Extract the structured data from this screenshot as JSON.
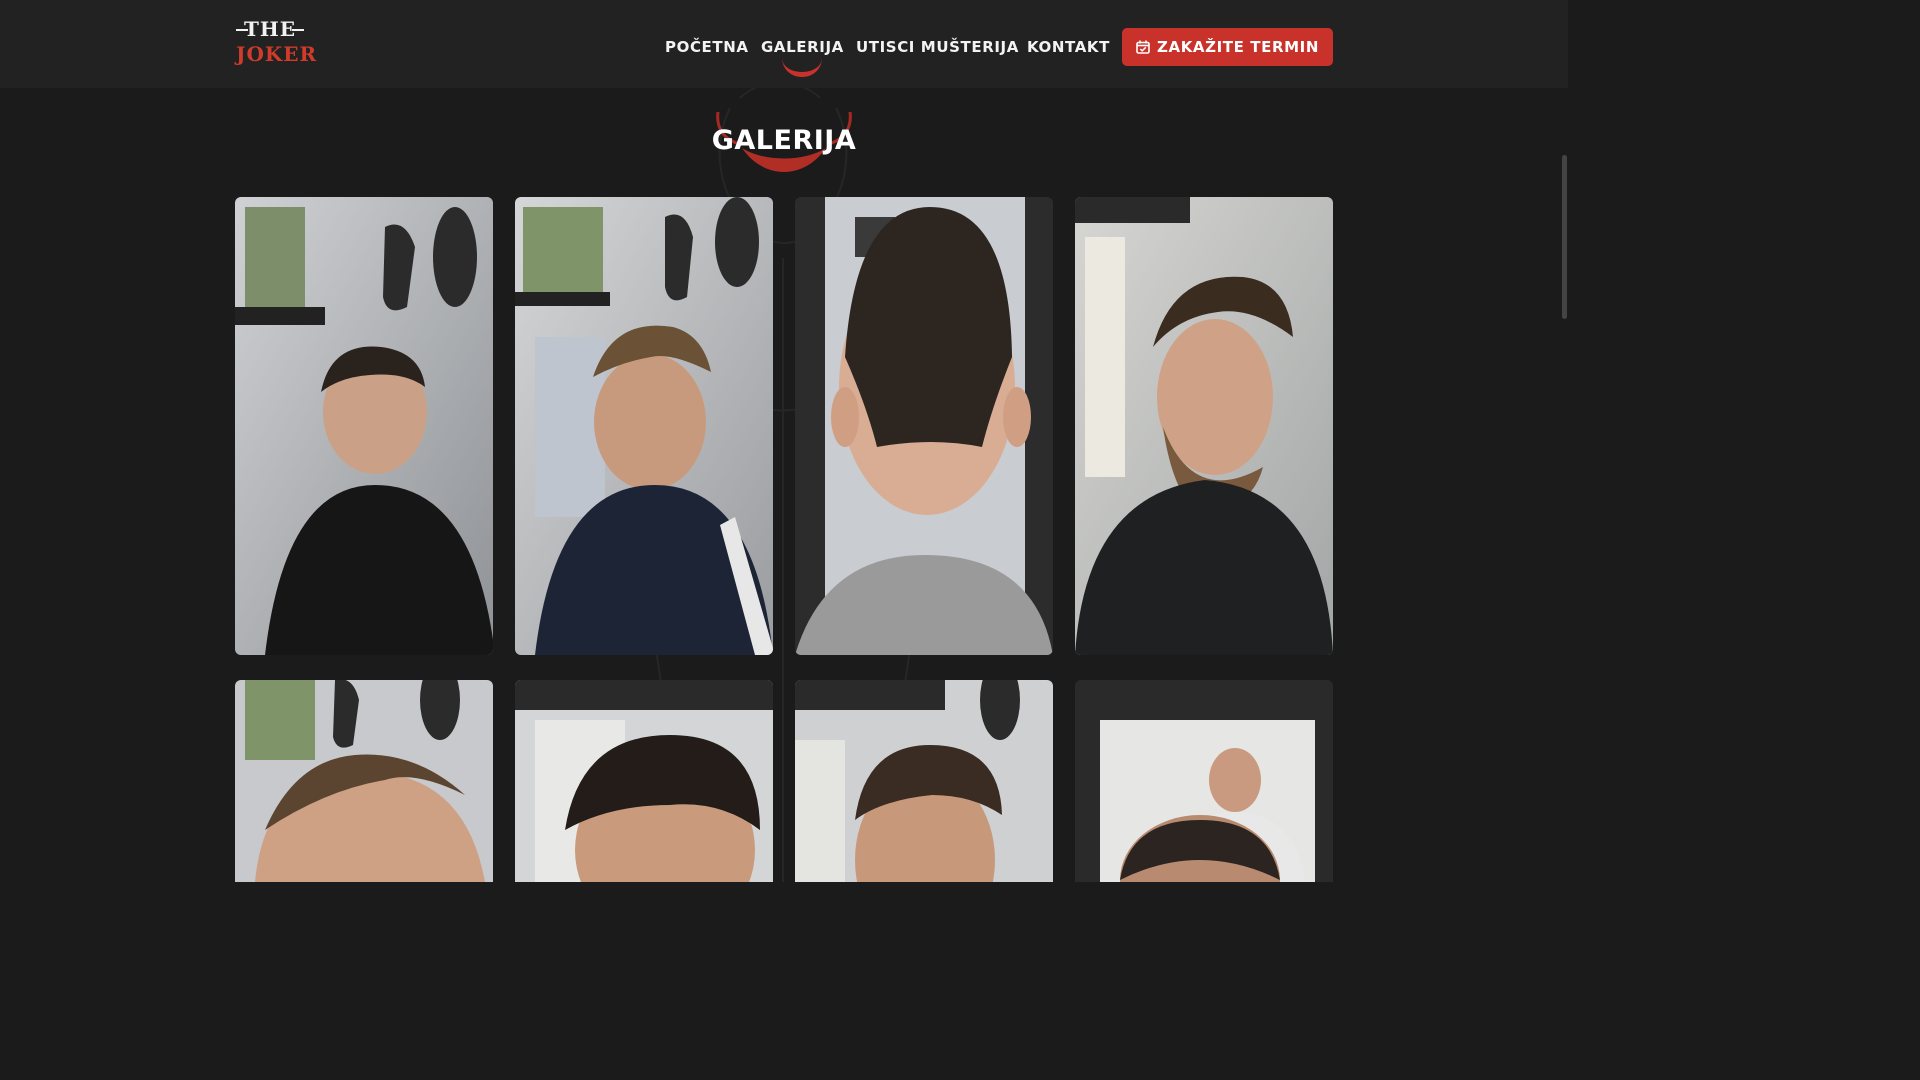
{
  "brand": {
    "line1": "THE",
    "line2": "JOKER"
  },
  "nav": {
    "items": [
      {
        "label": "POČETNA"
      },
      {
        "label": "GALERIJA"
      },
      {
        "label": "UTISCI MUŠTERIJA"
      },
      {
        "label": "KONTAKT"
      }
    ],
    "active_index": 1,
    "cta_label": "ZAKAŽITE TERMIN",
    "cta_icon": "calendar-check-icon"
  },
  "gallery": {
    "title": "GALERIJA",
    "photos": [
      {
        "subject": "haircut-side-profile-black-tshirt"
      },
      {
        "subject": "haircut-side-profile-track-jacket"
      },
      {
        "subject": "haircut-back-view-grey-shirt"
      },
      {
        "subject": "haircut-side-profile-beard-cape"
      },
      {
        "subject": "haircut-top-spiky"
      },
      {
        "subject": "haircut-textured-fringe"
      },
      {
        "subject": "haircut-front-fade"
      },
      {
        "subject": "haircut-short-back"
      }
    ]
  },
  "colors": {
    "accent": "#c8322a",
    "background": "#1b1b1b",
    "navbar": "#222222"
  }
}
